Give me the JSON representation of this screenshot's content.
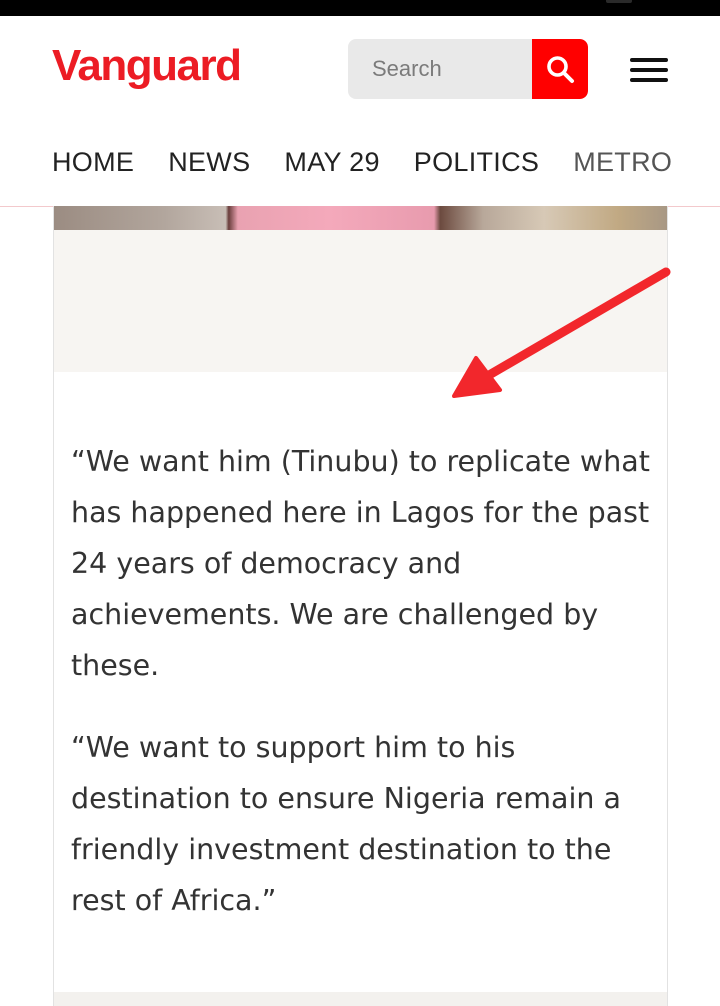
{
  "brand": {
    "name": "Vanguard",
    "color": "#ec1c24"
  },
  "search": {
    "placeholder": "Search",
    "button_color": "#ff0000",
    "icon": "search-icon"
  },
  "menu": {
    "icon": "hamburger-menu-icon"
  },
  "nav": {
    "items": [
      "HOME",
      "NEWS",
      "MAY 29",
      "POLITICS",
      "METRO"
    ]
  },
  "article": {
    "paragraphs": [
      "“We want him (Tinubu) to replicate what has happened here in Lagos for the past 24 years of democracy and achievements. We are challenged by these.",
      "“We want to support him to his destination to ensure Nigeria remain a friendly investment destination to the rest of Africa.”"
    ]
  },
  "annotation": {
    "type": "arrow",
    "color": "#f2272c"
  }
}
